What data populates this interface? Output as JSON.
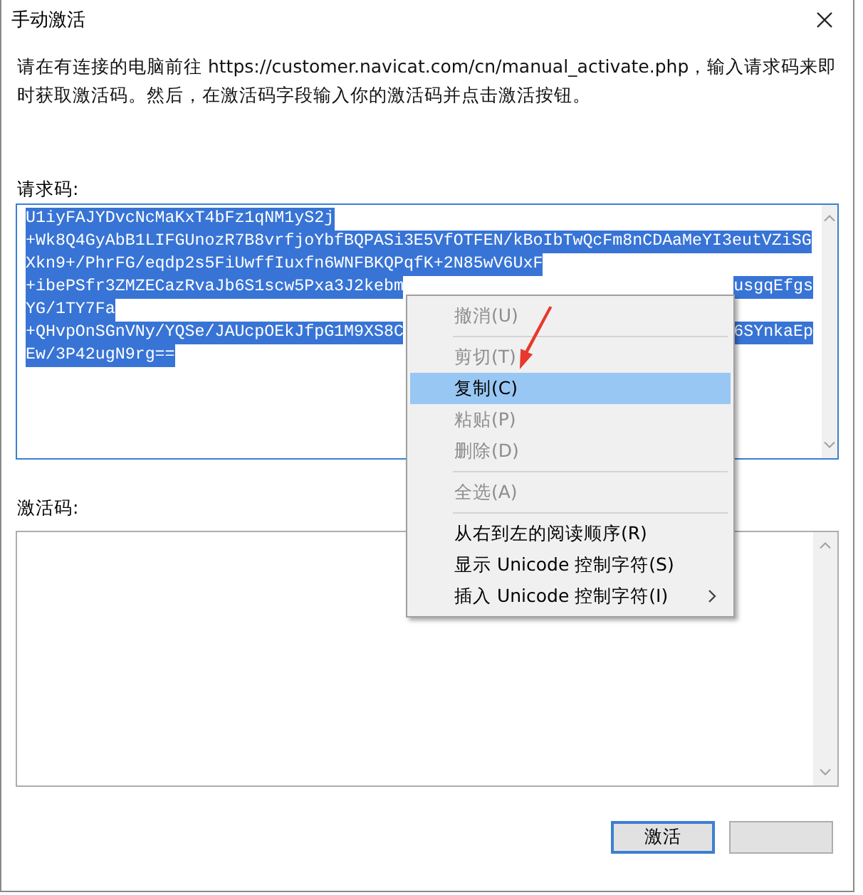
{
  "window": {
    "title": "手动激活"
  },
  "instructions": "请在有连接的电脑前往 https://customer.navicat.com/cn/manual_activate.php，输入请求码来即时获取激活码。然后，在激活码字段输入你的激活码并点击激活按钮。",
  "request_code": {
    "label": "请求码:",
    "selected": true,
    "lines": [
      {
        "parts": [
          "U1iyFAJYDvcNcMaKxT4bFz1qNM1yS2j"
        ]
      },
      {
        "parts": [
          "+Wk8Q4GyAbB1LIFGUnozR7B8vrfjoYbfBQPASi3E5VfOTFEN/kBoIbTwQcFm8nCDAaMeYI3eutVZiSG"
        ]
      },
      {
        "parts": [
          "Xkn9+/PhrFG/eqdp2s5FiUwffIuxfn6WNFBKQPqfK+2N85wV6UxF"
        ]
      },
      {
        "parts": [
          "+ibePSfr3ZMZECazRvaJb6S1scw5Pxa3J2kebm",
          "usgqEfgs"
        ]
      },
      {
        "parts": [
          "YG/1TY7Fa"
        ]
      },
      {
        "parts": [
          "+QHvpOnSGnVNy/YQSe/JAUcpOEkJfpG1M9XS8C",
          "6SYnkaEp"
        ]
      },
      {
        "parts": [
          "Ew/3P42ugN9rg=="
        ]
      }
    ]
  },
  "activation_code": {
    "label": "激活码:"
  },
  "context_menu": {
    "items": [
      {
        "kind": "item",
        "label": "撤消(U)",
        "disabled": true,
        "selected": false,
        "submenu": false
      },
      {
        "kind": "separator"
      },
      {
        "kind": "item",
        "label": "剪切(T)",
        "disabled": true,
        "selected": false,
        "submenu": false
      },
      {
        "kind": "item",
        "label": "复制(C)",
        "disabled": false,
        "selected": true,
        "submenu": false
      },
      {
        "kind": "item",
        "label": "粘贴(P)",
        "disabled": true,
        "selected": false,
        "submenu": false
      },
      {
        "kind": "item",
        "label": "删除(D)",
        "disabled": true,
        "selected": false,
        "submenu": false
      },
      {
        "kind": "separator"
      },
      {
        "kind": "item",
        "label": "全选(A)",
        "disabled": true,
        "selected": false,
        "submenu": false
      },
      {
        "kind": "separator"
      },
      {
        "kind": "item",
        "label": "从右到左的阅读顺序(R)",
        "disabled": false,
        "selected": false,
        "submenu": false
      },
      {
        "kind": "item",
        "label": "显示 Unicode 控制字符(S)",
        "disabled": false,
        "selected": false,
        "submenu": false
      },
      {
        "kind": "item",
        "label": "插入 Unicode 控制字符(I)",
        "disabled": false,
        "selected": false,
        "submenu": true
      }
    ]
  },
  "buttons": [
    {
      "label": "激活",
      "focused": true
    },
    {
      "focused": false
    }
  ]
}
